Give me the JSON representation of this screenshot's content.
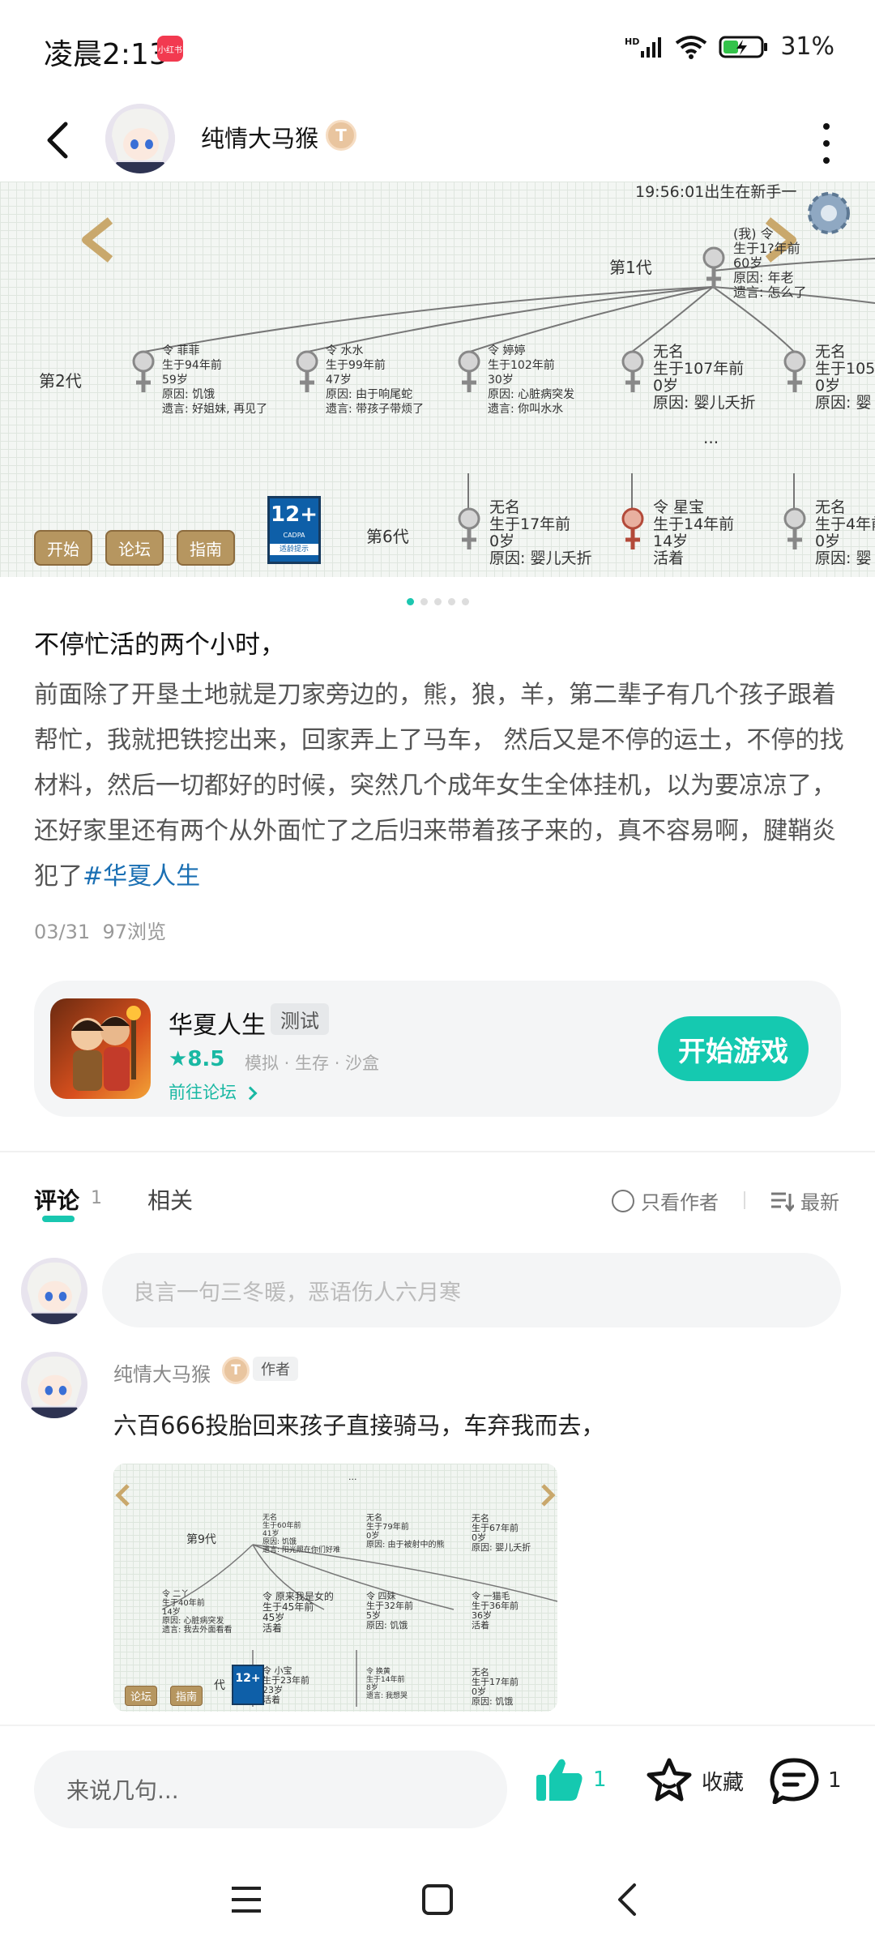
{
  "status_bar": {
    "time": "凌晨2:13",
    "badge": "小红书",
    "battery": "31%"
  },
  "header": {
    "author_name": "纯情大马猴",
    "level": "T"
  },
  "banner": {
    "top_status": "19:56:01出生在新手一",
    "gen1": {
      "label": "第1代",
      "info": "(我) 令\n生于1?年前\n60岁\n原因: 年老\n遗言: 怎么了"
    },
    "gen2": {
      "label": "第2代",
      "people": [
        "令 菲菲\n生于94年前\n59岁\n原因: 饥饿\n遗言: 好姐妹, 再见了",
        "令 水水\n生于99年前\n47岁\n原因: 由于响尾蛇\n遗言: 带孩子带烦了",
        "令 婷婷\n生于102年前\n30岁\n原因: 心脏病突发\n遗言: 你叫水水",
        "无名\n生于107年前\n0岁\n原因: 婴儿夭折",
        "无名\n生于105\n0岁\n原因: 婴"
      ]
    },
    "ellipsis": "...",
    "gen6": {
      "label": "第6代",
      "people": [
        "无名\n生于17年前\n0岁\n原因: 婴儿夭折",
        "令 星宝\n生于14年前\n14岁\n活着",
        "无名\n生于4年前\n0岁\n原因: 婴"
      ]
    },
    "buttons": [
      "开始",
      "论坛",
      "指南"
    ],
    "cadpa": {
      "age": "12+",
      "org": "CADPA",
      "tip": "适龄提示"
    }
  },
  "post": {
    "title": "不停忙活的两个小时，",
    "body": "前面除了开垦土地就是刀家旁边的，熊，狼，羊，第二辈子有几个孩子跟着帮忙，我就把铁挖出来，回家弄上了马车， 然后又是不停的运土，不停的找材料，然后一切都好的时候，突然几个成年女生全体挂机，以为要凉凉了， 还好家里还有两个从外面忙了之后归来带着孩子来的，真不容易啊，腱鞘炎犯了",
    "hashtag": "#华夏人生",
    "date": "03/31",
    "views": "97浏览"
  },
  "game": {
    "name": "华夏人生",
    "tag": "测试",
    "score": "8.5",
    "genres": "模拟 · 生存 · 沙盒",
    "forum_link": "前往论坛",
    "play_label": "开始游戏"
  },
  "tabs": {
    "comment_label": "评论",
    "comment_count": "1",
    "related_label": "相关",
    "only_author": "只看作者",
    "sort": "最新"
  },
  "comment_input_placeholder": "良言一句三冬暖，恶语伤人六月寒",
  "comment": {
    "author": "纯情大马猴",
    "author_tag": "作者",
    "text": "六百666投胎回来孩子直接骑马，车弃我而去，",
    "image": {
      "ellipsis": "...",
      "gen9": "第9代",
      "top_people": [
        "无名\n生于60年前\n41岁\n原因: 饥饿\n遗言: 阳光照在你们好难",
        "无名\n生于79年前\n0岁\n原因: 由于被射中的熊",
        "无名\n生于67年前\n0岁\n原因: 婴儿夭折"
      ],
      "mid_people": [
        "令 二丫\n生于40年前\n14岁\n原因: 心脏病突发\n遗言: 我去外面看看",
        "令 原来我是女的\n生于45年前\n45岁\n活着",
        "令 四妹\n生于32年前\n5岁\n原因: 饥饿",
        "令 一猫毛\n生于36年前\n36岁\n活着"
      ],
      "bottom_people": [
        "令 小宝\n生于23年前\n23岁\n活着",
        "令 换黄\n生于14年前\n8岁\n遗言: 我想哭",
        "无名\n生于17年前\n0岁\n原因: 饥饿"
      ],
      "buttons": [
        "论坛",
        "指南"
      ],
      "gen_partial": "代"
    }
  },
  "bottom_bar": {
    "reply_placeholder": "来说几句...",
    "like_count": "1",
    "favorite_label": "收藏",
    "comment_count": "1"
  },
  "colors": {
    "accent": "#15c9b0",
    "hashtag": "#1a6fb3",
    "banner_button": "#b69660"
  }
}
